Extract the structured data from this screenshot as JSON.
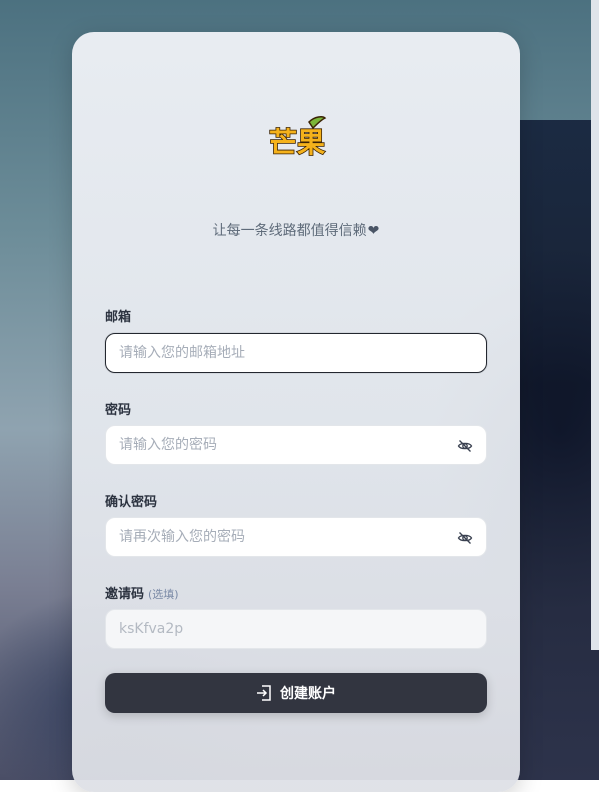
{
  "brand": {
    "logo_text": "芒果",
    "tagline": "让每一条线路都值得信赖",
    "tagline_heart": "❤"
  },
  "form": {
    "email": {
      "label": "邮箱",
      "placeholder": "请输入您的邮箱地址",
      "value": ""
    },
    "password": {
      "label": "密码",
      "placeholder": "请输入您的密码",
      "value": "",
      "toggle_icon": "eye-off-icon"
    },
    "confirm_password": {
      "label": "确认密码",
      "placeholder": "请再次输入您的密码",
      "value": "",
      "toggle_icon": "eye-off-icon"
    },
    "invite_code": {
      "label": "邀请码",
      "optional_note": "(选填)",
      "placeholder": "ksKfva2p",
      "value": ""
    },
    "submit": {
      "label": "创建账户",
      "icon": "login-icon"
    }
  },
  "colors": {
    "logo_fill": "#f5b21b",
    "logo_stroke": "#3a2205",
    "leaf": "#7bb63a",
    "button_bg": "#323540"
  }
}
